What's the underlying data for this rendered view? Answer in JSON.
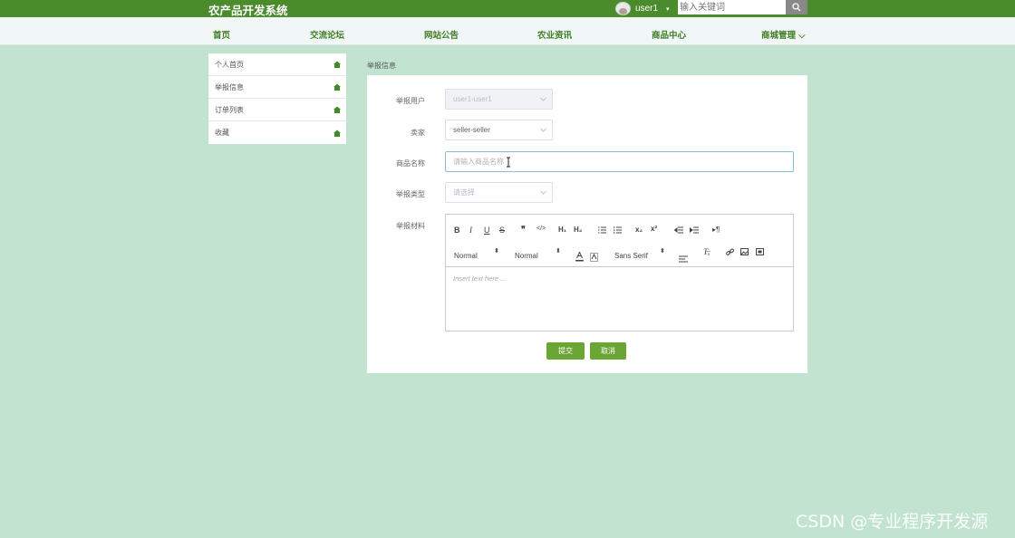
{
  "header": {
    "brand": "农产品开发系统",
    "username": "user1",
    "caret": "▾",
    "search_placeholder": "输入关键词"
  },
  "nav": [
    "首页",
    "交流论坛",
    "网站公告",
    "农业资讯",
    "商品中心",
    "商城管理 ⌵"
  ],
  "sidebar": {
    "items": [
      {
        "label": "个人首页"
      },
      {
        "label": "举报信息"
      },
      {
        "label": "订单列表"
      },
      {
        "label": "收藏"
      }
    ]
  },
  "breadcrumb": "举报信息",
  "form": {
    "reporter_label": "举报用户",
    "reporter_value": "user1-user1",
    "seller_label": "卖家",
    "seller_value": "seller-seller",
    "product_label": "商品名称",
    "product_placeholder": "请输入商品名称",
    "type_label": "举报类型",
    "type_placeholder": "请选择",
    "material_label": "举报材料"
  },
  "editor": {
    "header_select": "Normal",
    "size_select": "Normal",
    "font_select": "Sans Serif",
    "placeholder": "Insert text here ..."
  },
  "actions": {
    "submit": "提交",
    "cancel": "取消"
  },
  "watermark": "CSDN @专业程序开发源",
  "colors": {
    "header": "#4a8b2c",
    "background": "#c1e3cf",
    "button": "#6aa536",
    "nav_text": "#3f7d25"
  }
}
